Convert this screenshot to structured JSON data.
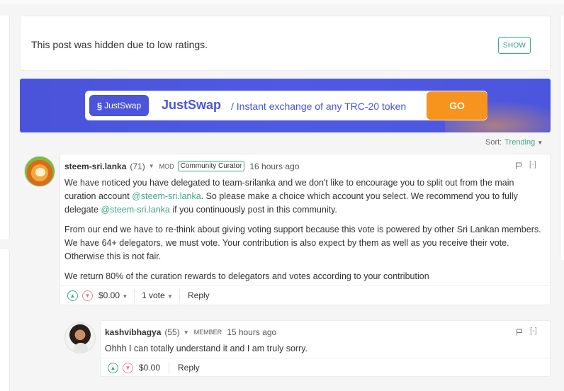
{
  "hidden_post": {
    "message": "This post was hidden due to low ratings.",
    "show_label": "SHOW"
  },
  "banner": {
    "logo_text": "JustSwap",
    "brand": "JustSwap",
    "tagline": "/ Instant exchange of any TRC-20 token",
    "cta": "GO",
    "brand_color": "#4b54da",
    "cta_color": "#f7941e"
  },
  "sort": {
    "label": "Sort:",
    "value": "Trending"
  },
  "comments": [
    {
      "author": "steem-sri.lanka",
      "reputation": "(71)",
      "role": "MOD",
      "badge": "Community Curator",
      "time": "16 hours ago",
      "collapse": "[-]",
      "p1_a": "We have noticed you have delegated to team-srilanka and we don't like to encourage you to split out from the main curation account ",
      "p1_link1": "@steem-sri.lanka",
      "p1_b": ". So please make a choice which account you select. We recommend you to fully delegate ",
      "p1_link2": "@steem-sri.lanka",
      "p1_c": " if you continuously post in this community.",
      "p2": "From our end we have to re-think about giving voting support because this vote is powered by other Sri Lankan members. We have 64+ delegators, we must vote. Your contribution is also expect by them as well as you receive their vote. Otherwise this is not fair.",
      "p3": "We return 80% of the curation rewards to delegators and votes according to your contribution",
      "payout": "$0.00",
      "votes": "1 vote",
      "reply": "Reply"
    },
    {
      "author": "kashvibhagya",
      "reputation": "(55)",
      "role": "MEMBER",
      "time": "15 hours ago",
      "collapse": "[-]",
      "body": "Ohhh I can totally understand it and I am truly sorry.",
      "payout": "$0.00",
      "reply": "Reply"
    }
  ],
  "icons": {
    "upvote": "chevron-up-icon",
    "downvote": "chevron-down-icon",
    "flag": "flag-icon",
    "dropdown": "caret-down-icon"
  },
  "colors": {
    "accent": "#3ea88c",
    "downvote": "#e07090"
  }
}
